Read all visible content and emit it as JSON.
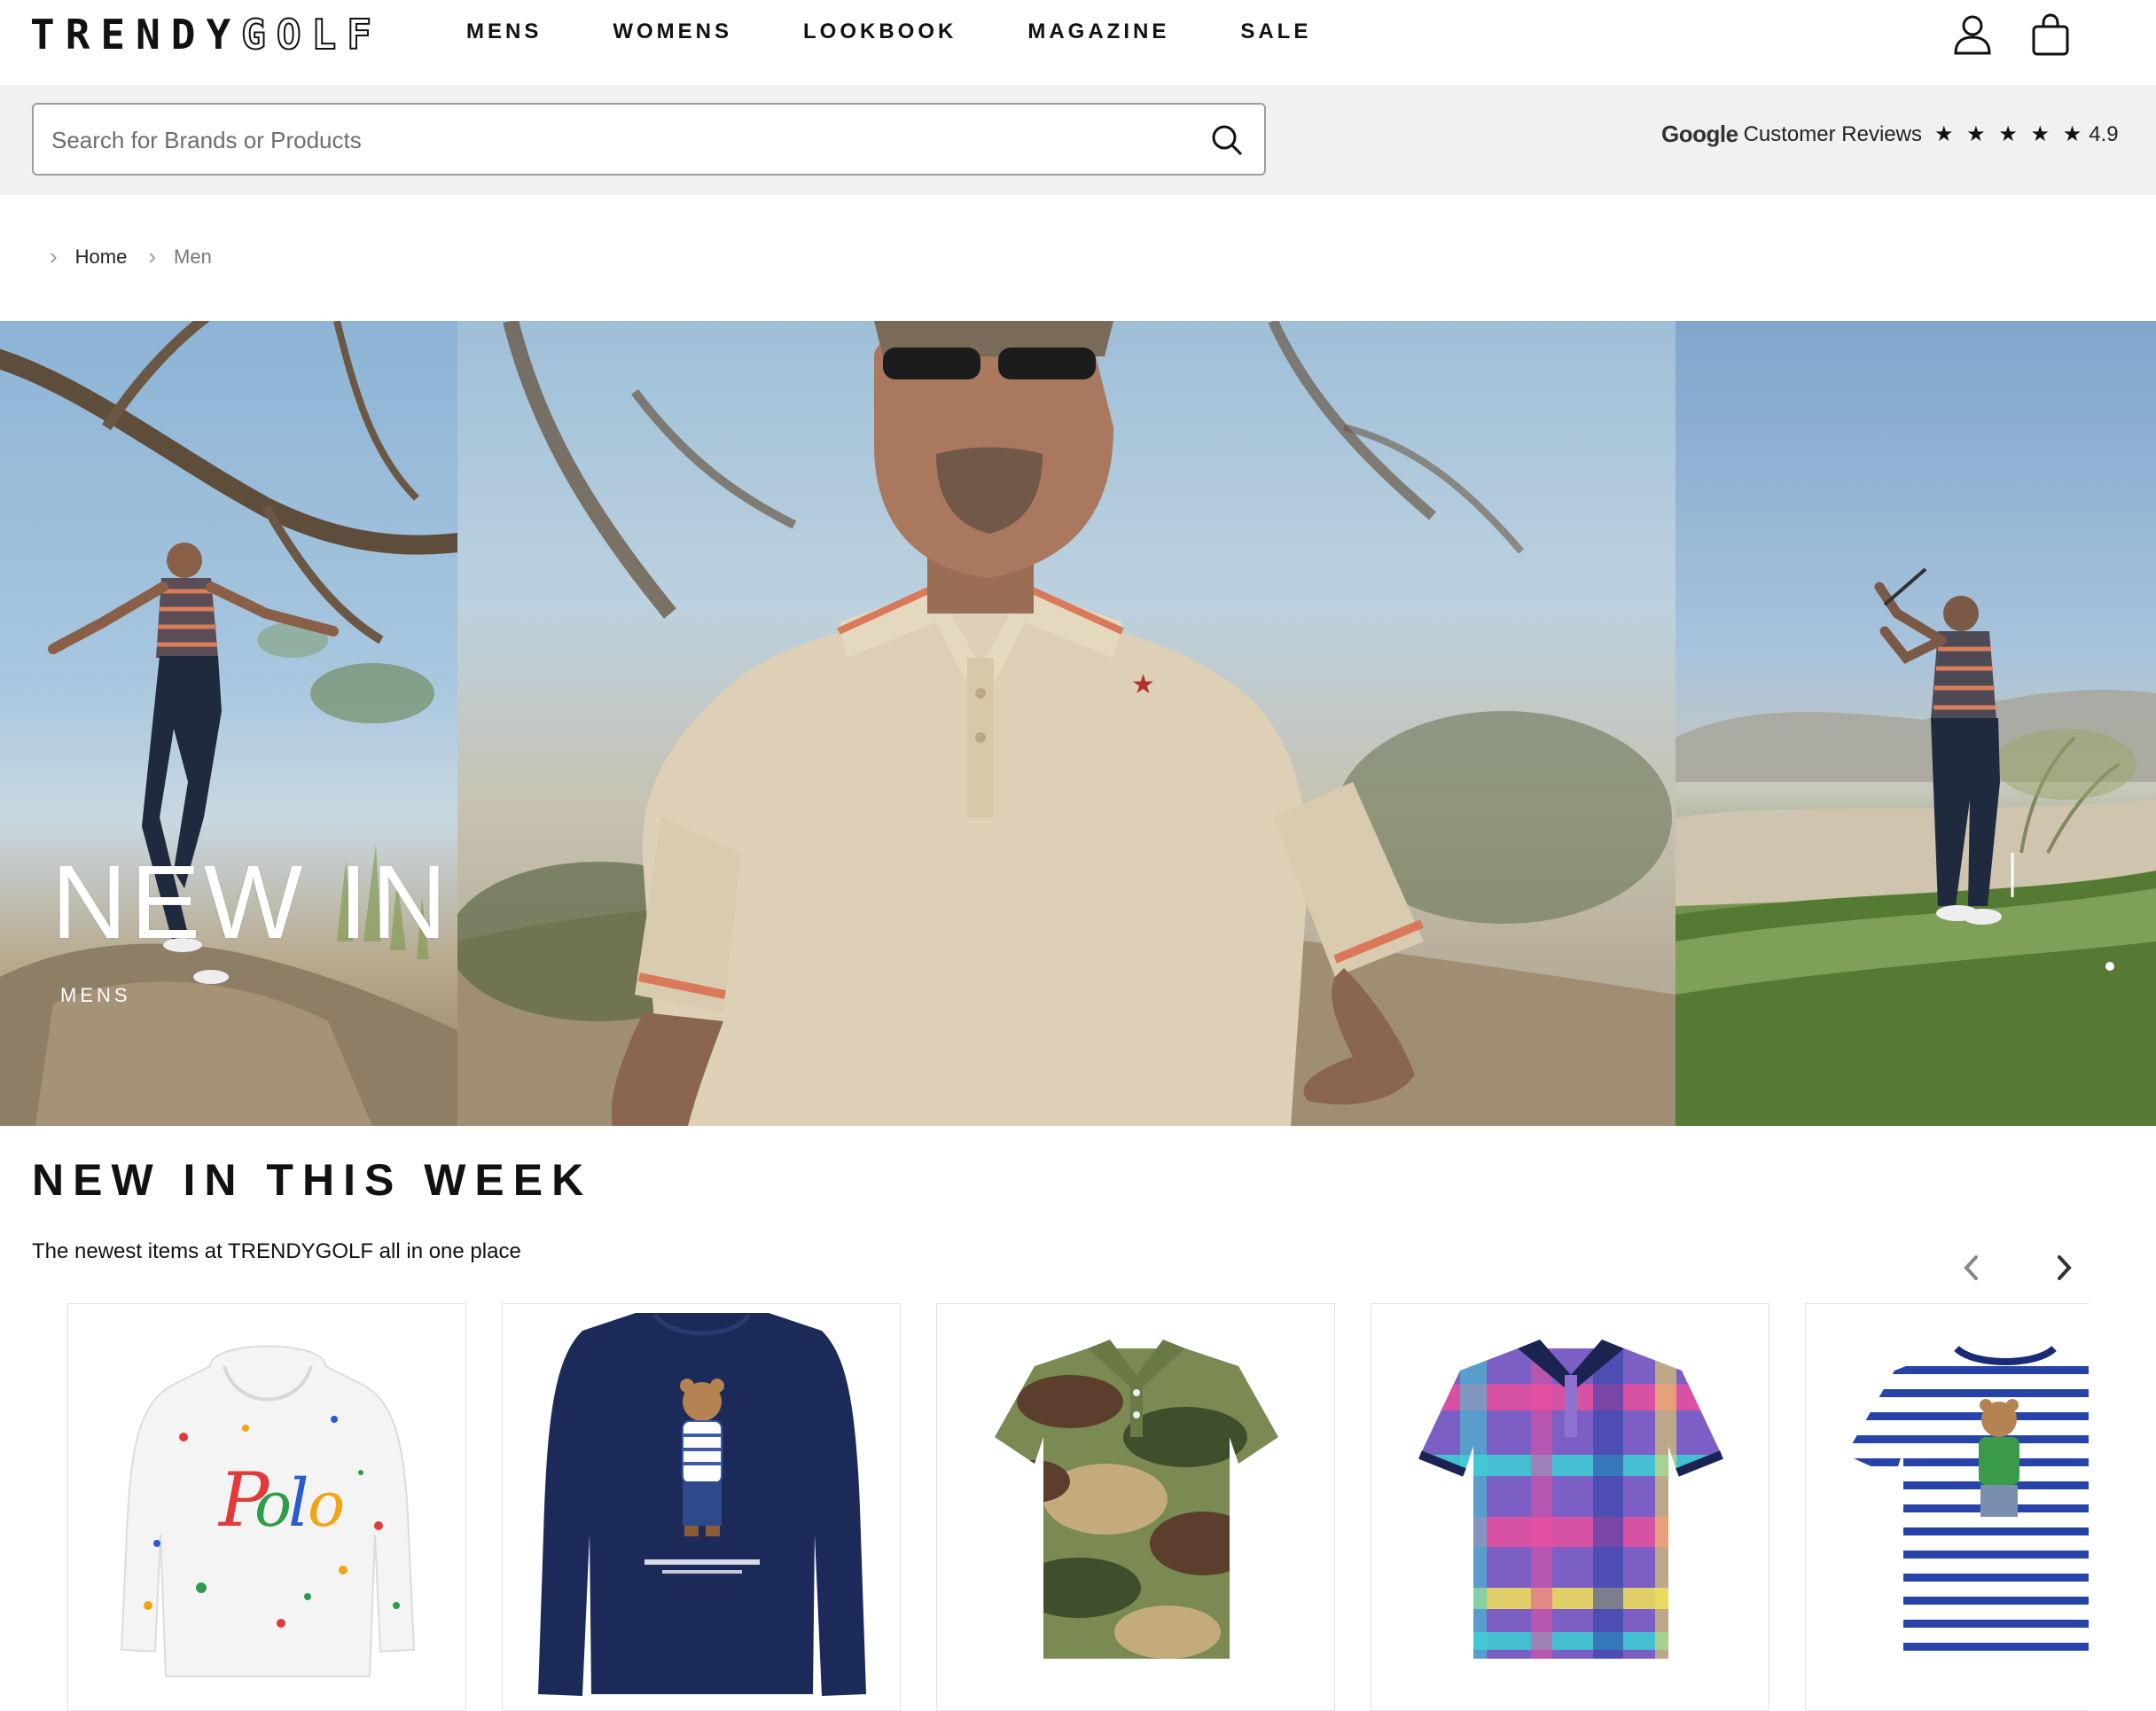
{
  "header": {
    "logo": {
      "part1": "TRENDY",
      "part2": "GOLF"
    },
    "nav": [
      "MENS",
      "WOMENS",
      "LOOKBOOK",
      "MAGAZINE",
      "SALE"
    ],
    "icons": [
      "account-icon",
      "bag-icon"
    ]
  },
  "search": {
    "placeholder": "Search for Brands or Products",
    "value": ""
  },
  "reviews": {
    "brand": "Google",
    "label": "Customer Reviews",
    "stars": "★ ★ ★ ★ ★",
    "rating": "4.9"
  },
  "breadcrumb": {
    "home": "Home",
    "current": "Men"
  },
  "hero": {
    "title": "NEW IN",
    "subtitle": "MENS"
  },
  "section": {
    "title": "NEW IN THIS WEEK",
    "subtitle": "The newest items at TRENDYGOLF all in one place"
  },
  "products": [
    {
      "product": "white paint-splatter hoodie"
    },
    {
      "product": "navy bear sweatshirt"
    },
    {
      "product": "camo polo shirt"
    },
    {
      "product": "plaid polo shirt"
    },
    {
      "product": "striped bear t-shirt"
    }
  ],
  "colors": {
    "search_band": "#f0f1f2",
    "text": "#111111",
    "border": "#9c9c9c"
  }
}
